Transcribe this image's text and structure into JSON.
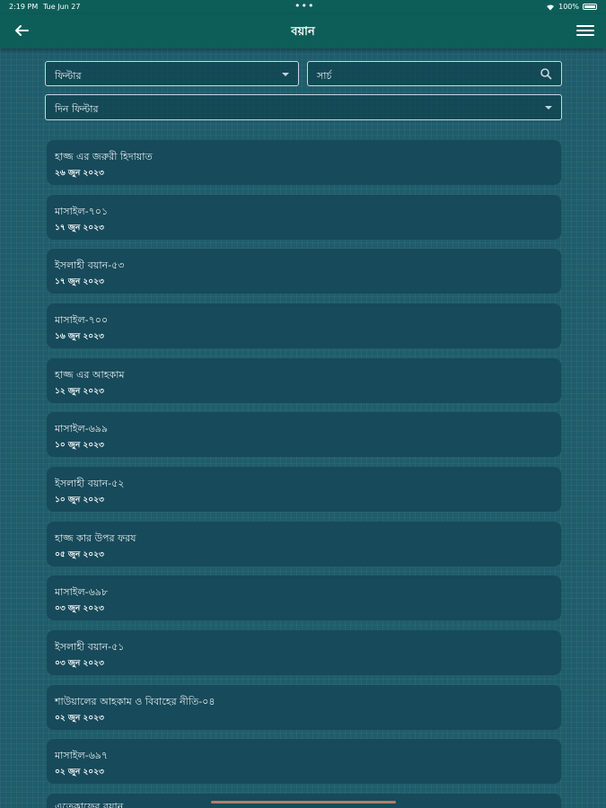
{
  "status_bar": {
    "time": "2:19 PM",
    "date": "Tue Jun 27",
    "dots": "•••",
    "battery": "100%"
  },
  "header": {
    "title": "বয়ান",
    "icons": {
      "back": "arrow-left-icon",
      "menu": "hamburger-menu-icon"
    }
  },
  "filters": {
    "filter_label": "ফিল্টার",
    "search_placeholder": "সার্চ",
    "day_filter_label": "দিন ফিল্টার"
  },
  "items": [
    {
      "title": "হাজ্জ এর জরুরী হিদায়াত",
      "date": "২৬ জুন ২০২৩"
    },
    {
      "title": "মাসাইল-৭০১",
      "date": "১৭ জুন ২০২৩"
    },
    {
      "title": "ইসলাহী বয়ান-৫৩",
      "date": "১৭ জুন ২০২৩"
    },
    {
      "title": "মাসাইল-৭০০",
      "date": "১৬ জুন ২০২৩"
    },
    {
      "title": "হাজ্জ এর আহকাম",
      "date": "১২ জুন ২০২৩"
    },
    {
      "title": "মাসাইল-৬৯৯",
      "date": "১০ জুন ২০২৩"
    },
    {
      "title": "ইসলাহী বয়ান-৫২",
      "date": "১০ জুন ২০২৩"
    },
    {
      "title": "হাজ্জ কার উপর ফরয",
      "date": "০৫ জুন ২০২৩"
    },
    {
      "title": "মাসাইল-৬৯৮",
      "date": "০৩ জুন ২০২৩"
    },
    {
      "title": "ইসলাহী বয়ান-৫১",
      "date": "০৩ জুন ২০২৩"
    },
    {
      "title": "শাউয়ালের আহকাম ও বিবাহের নীতি-০৪",
      "date": "০২ জুন ২০২৩"
    },
    {
      "title": "মাসাইল-৬৯৭",
      "date": "০২ জুন ২০২৩"
    },
    {
      "title": "এতেকাফের বয়ান",
      "date": ""
    }
  ],
  "colors": {
    "app_bar": "#0d5e59",
    "background": "#1f5d6c",
    "card": "#174a5a"
  }
}
